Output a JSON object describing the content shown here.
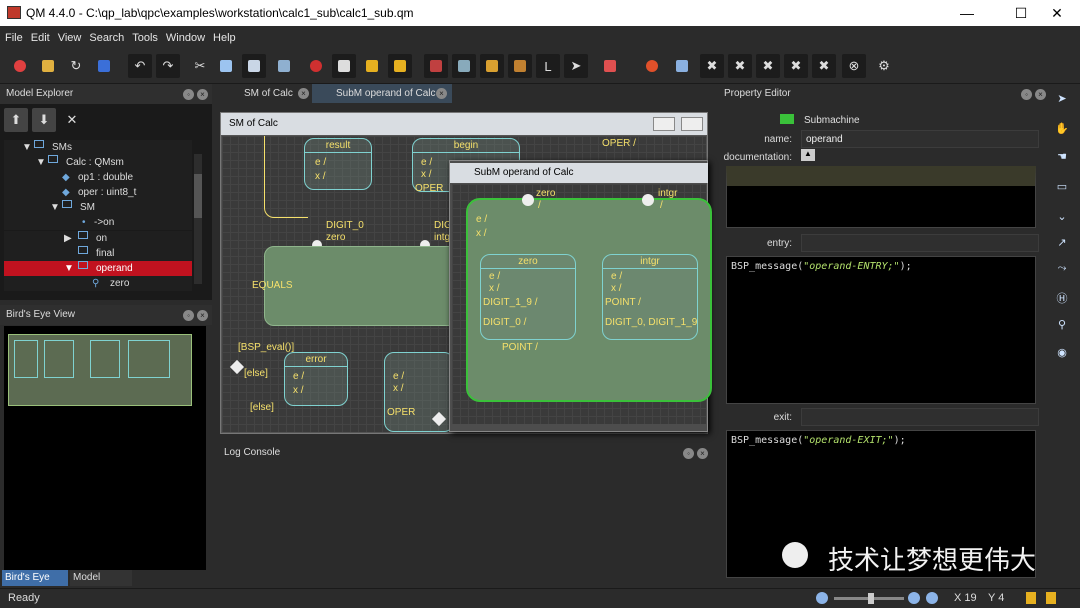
{
  "window": {
    "title": "QM 4.4.0 - C:\\qp_lab\\qpc\\examples\\workstation\\calc1_sub\\calc1_sub.qm",
    "minimize": "—",
    "maximize": "☐",
    "close": "✕"
  },
  "menu": [
    "File",
    "Edit",
    "View",
    "Search",
    "Tools",
    "Window",
    "Help"
  ],
  "model_explorer": {
    "title": "Model Explorer",
    "tree": [
      {
        "label": "SMs",
        "arrow": "▼"
      },
      {
        "label": "Calc : QMsm",
        "arrow": "▼"
      },
      {
        "label": "op1 : double"
      },
      {
        "label": "oper : uint8_t"
      },
      {
        "label": "SM",
        "arrow": "▼"
      },
      {
        "label": "->on"
      },
      {
        "label": "on",
        "arrow": "▶"
      },
      {
        "label": "final"
      },
      {
        "label": "operand",
        "arrow": "▼",
        "selected": true
      },
      {
        "label": "zero"
      }
    ]
  },
  "birds_eye": {
    "title": "Bird's Eye View"
  },
  "bottom_tabs": [
    "Bird's Eye View",
    "Model Search"
  ],
  "tabs": [
    "SM of Calc",
    "SubM operand of Calc"
  ],
  "sm_window": {
    "title": "SM of Calc",
    "states": {
      "result": "result",
      "begin": "begin",
      "error": "error",
      "equals": "EQUALS"
    },
    "labels": {
      "e": "e /",
      "x": "x /",
      "oper": "OPER",
      "oper2": "OPER /",
      "digit0": "DIGIT_0",
      "dig": "DIG",
      "zero": "zero",
      "intgr": "intgr",
      "bsp_eval": "[BSP_eval()]",
      "else1": "[else]",
      "else2": "[else]",
      "oper3": "OPER"
    }
  },
  "subm_window": {
    "title": "SubM operand of Calc",
    "labels": {
      "zero_top": "zero",
      "intgr_top": "intgr",
      "slash1": "/",
      "slash2": "/",
      "e": "e /",
      "x": "x /"
    },
    "zero_state": {
      "name": "zero",
      "e": "e /",
      "x": "x /",
      "t1": "DIGIT_1_9 /",
      "t2": "DIGIT_0 /"
    },
    "intgr_state": {
      "name": "intgr",
      "e": "e /",
      "x": "x /",
      "t1": "POINT /",
      "t2": "DIGIT_0, DIGIT_1_9"
    },
    "point": "POINT /"
  },
  "log_console": {
    "title": "Log Console"
  },
  "property_editor": {
    "title": "Property Editor",
    "type": "Submachine",
    "name_label": "name:",
    "name_value": "operand",
    "doc_label": "documentation:",
    "entry_label": "entry:",
    "entry_code_pre": "BSP_message(",
    "entry_code_str": "\"operand-ENTRY;\"",
    "entry_code_post": ");",
    "exit_label": "exit:",
    "exit_code_pre": "BSP_message(",
    "exit_code_str": "\"operand-EXIT;\"",
    "exit_code_post": ");"
  },
  "watermark": "技术让梦想更伟大",
  "status": {
    "text": "Ready",
    "x": "X 19",
    "y": "Y 4"
  }
}
